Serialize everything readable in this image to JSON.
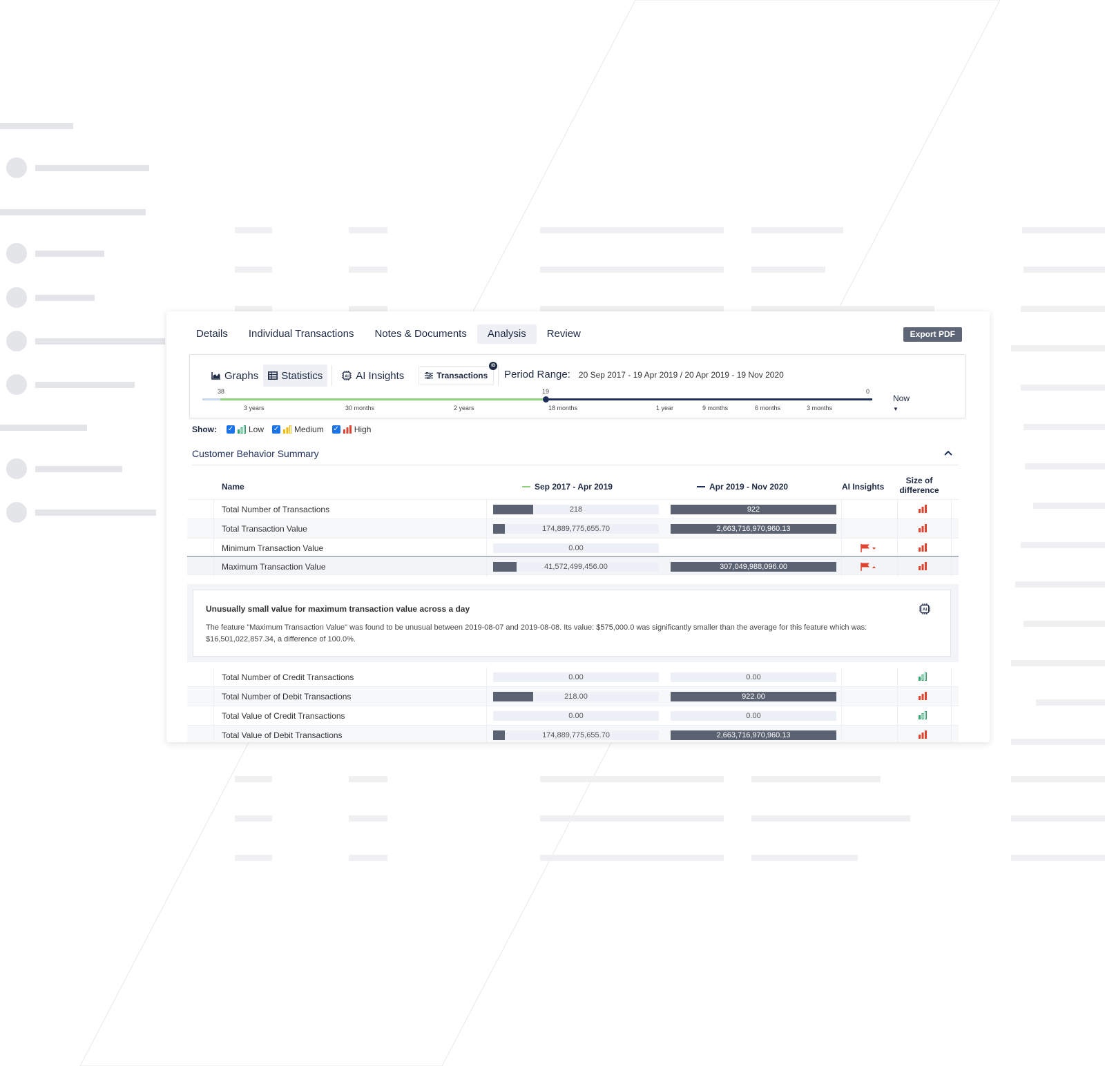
{
  "tabs": [
    "Details",
    "Individual Transactions",
    "Notes & Documents",
    "Analysis",
    "Review"
  ],
  "active_tab": "Analysis",
  "export_label": "Export PDF",
  "views": {
    "graphs": "Graphs",
    "statistics": "Statistics",
    "ai_insights": "AI Insights",
    "transactions": "Transactions"
  },
  "period": {
    "label": "Period Range:",
    "value": "20 Sep 2017 - 19 Apr 2019 / 20 Apr 2019 - 19 Nov 2020"
  },
  "timeline": {
    "numbers": [
      "38",
      "19",
      "0"
    ],
    "labels": [
      "3 years",
      "30 months",
      "2 years",
      "18 months",
      "1 year",
      "9 months",
      "6 months",
      "3 months"
    ],
    "now_label": "Now"
  },
  "show": {
    "label": "Show:",
    "low": "Low",
    "medium": "Medium",
    "high": "High"
  },
  "summary_title": "Customer Behavior Summary",
  "columns": {
    "name": "Name",
    "period1": "Sep 2017 - Apr 2019",
    "period2": "Apr 2019 - Nov 2020",
    "ai": "AI Insights",
    "size1": "Size of",
    "size2": "difference"
  },
  "rows": [
    {
      "name": "Total Number of Transactions",
      "v1": "218",
      "v2": "922",
      "f1": 0.24,
      "f2": 1.0,
      "flag": "",
      "level": "high"
    },
    {
      "name": "Total Transaction Value",
      "v1": "174,889,775,655.70",
      "v2": "2,663,716,970,960.13",
      "f1": 0.07,
      "f2": 1.0,
      "flag": "",
      "level": "high"
    },
    {
      "name": "Minimum Transaction Value",
      "v1": "0.00",
      "v2": "",
      "f1": 0,
      "f2": 0,
      "flag": "down",
      "level": "high"
    },
    {
      "name": "Maximum Transaction Value",
      "v1": "41,572,499,456.00",
      "v2": "307,049,988,096.00",
      "f1": 0.14,
      "f2": 1.0,
      "flag": "up",
      "level": "high"
    },
    {
      "name": "Total Number of Credit Transactions",
      "v1": "0.00",
      "v2": "0.00",
      "f1": 0,
      "f2": 0,
      "flag": "",
      "level": "low"
    },
    {
      "name": "Total Number of Debit Transactions",
      "v1": "218.00",
      "v2": "922.00",
      "f1": 0.24,
      "f2": 1.0,
      "flag": "",
      "level": "high"
    },
    {
      "name": "Total Value of Credit Transactions",
      "v1": "0.00",
      "v2": "0.00",
      "f1": 0,
      "f2": 0,
      "flag": "",
      "level": "low"
    },
    {
      "name": "Total Value of Debit Transactions",
      "v1": "174,889,775,655.70",
      "v2": "2,663,716,970,960.13",
      "f1": 0.07,
      "f2": 1.0,
      "flag": "",
      "level": "high"
    }
  ],
  "insight": {
    "title": "Unusually small value for maximum transaction value across a day",
    "body": "The feature \"Maximum Transaction Value\" was found to be unusual between 2019-08-07 and 2019-08-08. Its value: $575,000.0 was significantly smaller than the average for this feature which was: $16,501,022,857.34, a difference of 100.0%."
  },
  "colors": {
    "low": "#2ea36b",
    "medium": "#f2b705",
    "high": "#e0432f",
    "bar": "#5b6272",
    "accent": "#1f2f5b"
  }
}
